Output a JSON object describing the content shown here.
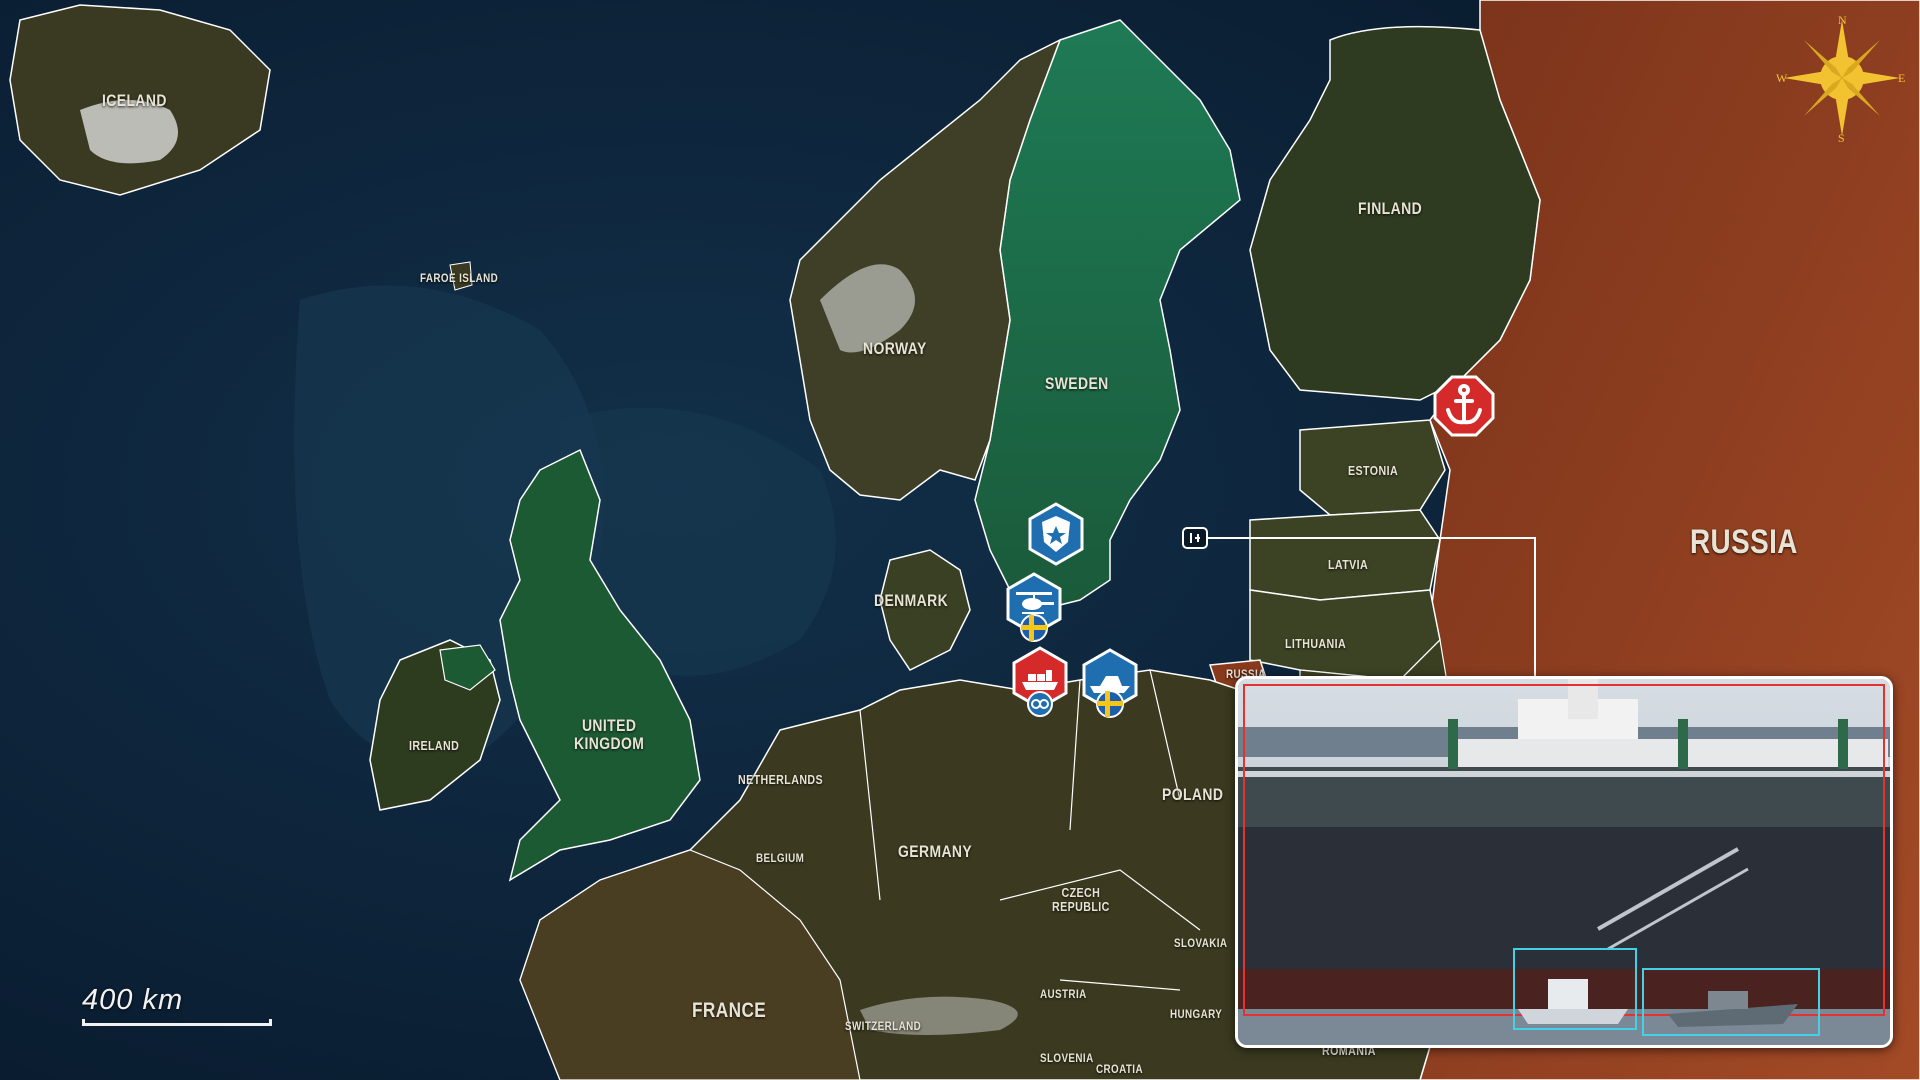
{
  "map": {
    "countries": [
      {
        "key": "iceland",
        "name": "ICELAND"
      },
      {
        "key": "faroe",
        "name": "FAROE ISLAND"
      },
      {
        "key": "norway",
        "name": "NORWAY"
      },
      {
        "key": "sweden",
        "name": "SWEDEN"
      },
      {
        "key": "finland",
        "name": "FINLAND"
      },
      {
        "key": "russia",
        "name": "RUSSIA"
      },
      {
        "key": "estonia",
        "name": "ESTONIA"
      },
      {
        "key": "latvia",
        "name": "LATVIA"
      },
      {
        "key": "lithuania",
        "name": "LITHUANIA"
      },
      {
        "key": "russia_kaliningrad",
        "name": "RUSSIA"
      },
      {
        "key": "denmark",
        "name": "DENMARK"
      },
      {
        "key": "ireland",
        "name": "IRELAND"
      },
      {
        "key": "uk",
        "name": "UNITED\nKINGDOM"
      },
      {
        "key": "netherlands",
        "name": "NETHERLANDS"
      },
      {
        "key": "belgium",
        "name": "BELGIUM"
      },
      {
        "key": "germany",
        "name": "GERMANY"
      },
      {
        "key": "poland",
        "name": "POLAND"
      },
      {
        "key": "czech",
        "name": "CZECH\nREPUBLIC"
      },
      {
        "key": "slovakia",
        "name": "SLOVAKIA"
      },
      {
        "key": "austria",
        "name": "AUSTRIA"
      },
      {
        "key": "hungary",
        "name": "HUNGARY"
      },
      {
        "key": "france",
        "name": "FRANCE"
      },
      {
        "key": "switzerland",
        "name": "SWITZERLAND"
      },
      {
        "key": "slovenia",
        "name": "SLOVENIA"
      },
      {
        "key": "croatia",
        "name": "CROATIA"
      },
      {
        "key": "romania",
        "name": "ROMANIA"
      }
    ],
    "scale_label": "400 km",
    "compass": {
      "n": "N",
      "s": "S",
      "e": "E",
      "w": "W"
    },
    "colors": {
      "ocean": "#0d2236",
      "land_neutral": "#3a3a20",
      "land_highlight": "#1f5e3a",
      "russia": "#8a3a1c",
      "border": "#ffffff",
      "marker_blue": "#1f6fb0",
      "marker_red": "#d42a2a",
      "compass_gold": "#f2c230"
    },
    "markers": [
      {
        "key": "police",
        "icon": "police-badge-icon",
        "color": "blue"
      },
      {
        "key": "helicopter",
        "icon": "helicopter-icon",
        "color": "blue",
        "flag": "sweden-flag-icon"
      },
      {
        "key": "cargo_ship",
        "icon": "cargo-ship-icon",
        "color": "red",
        "sub_icon": "coast-guard-icon"
      },
      {
        "key": "patrol_boat",
        "icon": "patrol-boat-icon",
        "color": "blue",
        "flag": "sweden-flag-icon"
      },
      {
        "key": "anchor",
        "icon": "anchor-icon",
        "color": "red"
      }
    ]
  },
  "inset": {
    "description_icon": "tanker-boarding-photo",
    "highlight_colors": {
      "frame": "#e23232",
      "boxes": "#44d0e6"
    }
  }
}
